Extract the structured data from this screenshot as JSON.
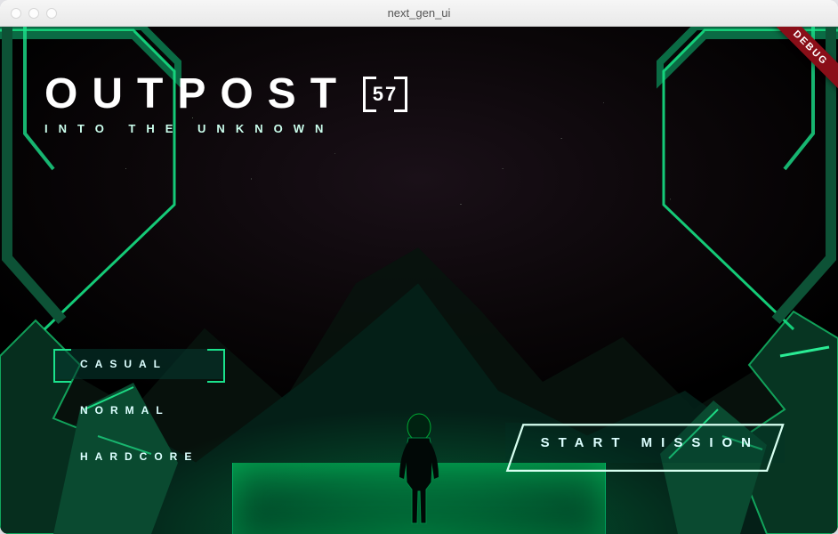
{
  "window": {
    "title": "next_gen_ui"
  },
  "debug_ribbon": "DEBUG",
  "game_title": {
    "main": "OUTPOST",
    "badge": "57",
    "subtitle": "INTO THE UNKNOWN"
  },
  "difficulty": {
    "options": [
      {
        "label": "CASUAL",
        "selected": true
      },
      {
        "label": "NORMAL",
        "selected": false
      },
      {
        "label": "HARDCORE",
        "selected": false
      }
    ]
  },
  "start_button": {
    "label": "START MISSION"
  },
  "colors": {
    "accent": "#1be28c",
    "accent_dark": "#0a6b44"
  }
}
